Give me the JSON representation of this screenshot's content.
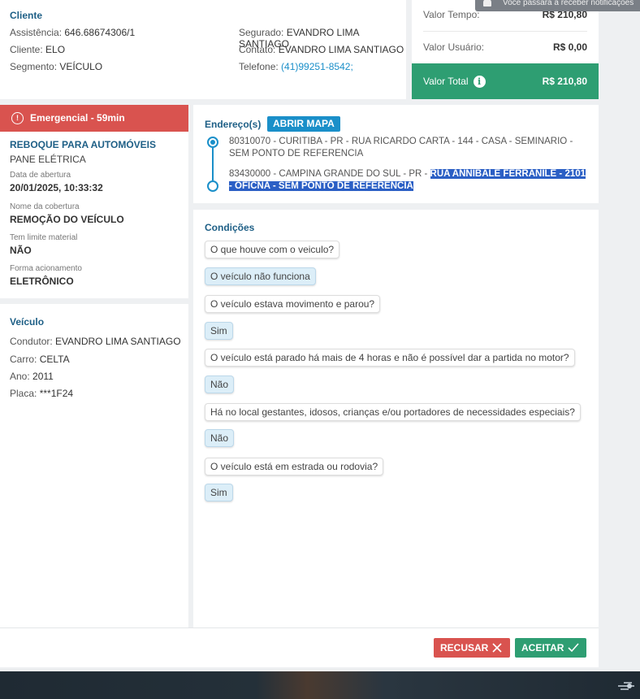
{
  "notification": {
    "text": "Você passará a receber notificações"
  },
  "cliente": {
    "title": "Cliente",
    "assistencia_label": "Assistência:",
    "assistencia": "646.68674306/1",
    "cliente_label": "Cliente:",
    "cliente": "ELO",
    "segmento_label": "Segmento:",
    "segmento": "VEÍCULO",
    "segurado_label": "Segurado:",
    "segurado": "EVANDRO LIMA SANTIAGO",
    "contato_label": "Contato:",
    "contato": "EVANDRO LIMA SANTIAGO",
    "telefone_label": "Telefone:",
    "telefone": "(41)99251-8542;"
  },
  "valores": {
    "tempo_label": "Valor Tempo:",
    "tempo": "R$ 210,80",
    "usuario_label": "Valor Usuário:",
    "usuario": "R$ 0,00",
    "total_label": "Valor Total",
    "total": "R$ 210,80",
    "info_icon": "i"
  },
  "emergencia": {
    "header": "Emergencial - 59min",
    "servico": "REBOQUE PARA AUTOMÓVEIS",
    "problema": "PANE ELÉTRICA",
    "abertura_label": "Data de abertura",
    "abertura": "20/01/2025, 10:33:32",
    "cobertura_label": "Nome da cobertura",
    "cobertura": "REMOÇÃO DO VEÍCULO",
    "limite_label": "Tem limite material",
    "limite": "NÃO",
    "forma_label": "Forma acionamento",
    "forma": "ELETRÔNICO"
  },
  "veiculo": {
    "title": "Veículo",
    "condutor_label": "Condutor:",
    "condutor": "EVANDRO LIMA SANTIAGO",
    "carro_label": "Carro:",
    "carro": "CELTA",
    "ano_label": "Ano:",
    "ano": "2011",
    "placa_label": "Placa:",
    "placa": "***1F24"
  },
  "enderecos": {
    "title": "Endereço(s)",
    "map_button": "ABRIR MAPA",
    "origem": "80310070 - CURITIBA - PR - RUA RICARDO CARTA - 144 - CASA - SEMINARIO - SEM PONTO DE REFERENCIA",
    "destino_prefix": "83430000 - CAMPINA GRANDE DO SUL - PR - ",
    "destino_selected": "RUA ANNIBALE FERRANILE - 2101 - OFICNA - SEM PONTO DE REFERENCIA"
  },
  "condicoes": {
    "title": "Condições",
    "items": [
      {
        "question": "O que houve com o veiculo?",
        "answer": "O veículo não funciona"
      },
      {
        "question": "O veículo estava movimento e parou?",
        "answer": "Sim"
      },
      {
        "question": "O veículo está parado há mais de 4 horas e não é possível dar a partida no motor?",
        "answer": "Não"
      },
      {
        "question": "Há no local gestantes, idosos, crianças e/ou portadores de necessidades especiais?",
        "answer": "Não"
      },
      {
        "question": "O veículo está em estrada ou rodovia?",
        "answer": "Sim"
      }
    ]
  },
  "actions": {
    "recusar": "RECUSAR",
    "aceitar": "ACEITAR"
  },
  "icons": {
    "alert": "alert-circle-icon",
    "close": "x-icon",
    "check": "check-icon",
    "bell": "bell-icon",
    "network": "network-icon"
  }
}
